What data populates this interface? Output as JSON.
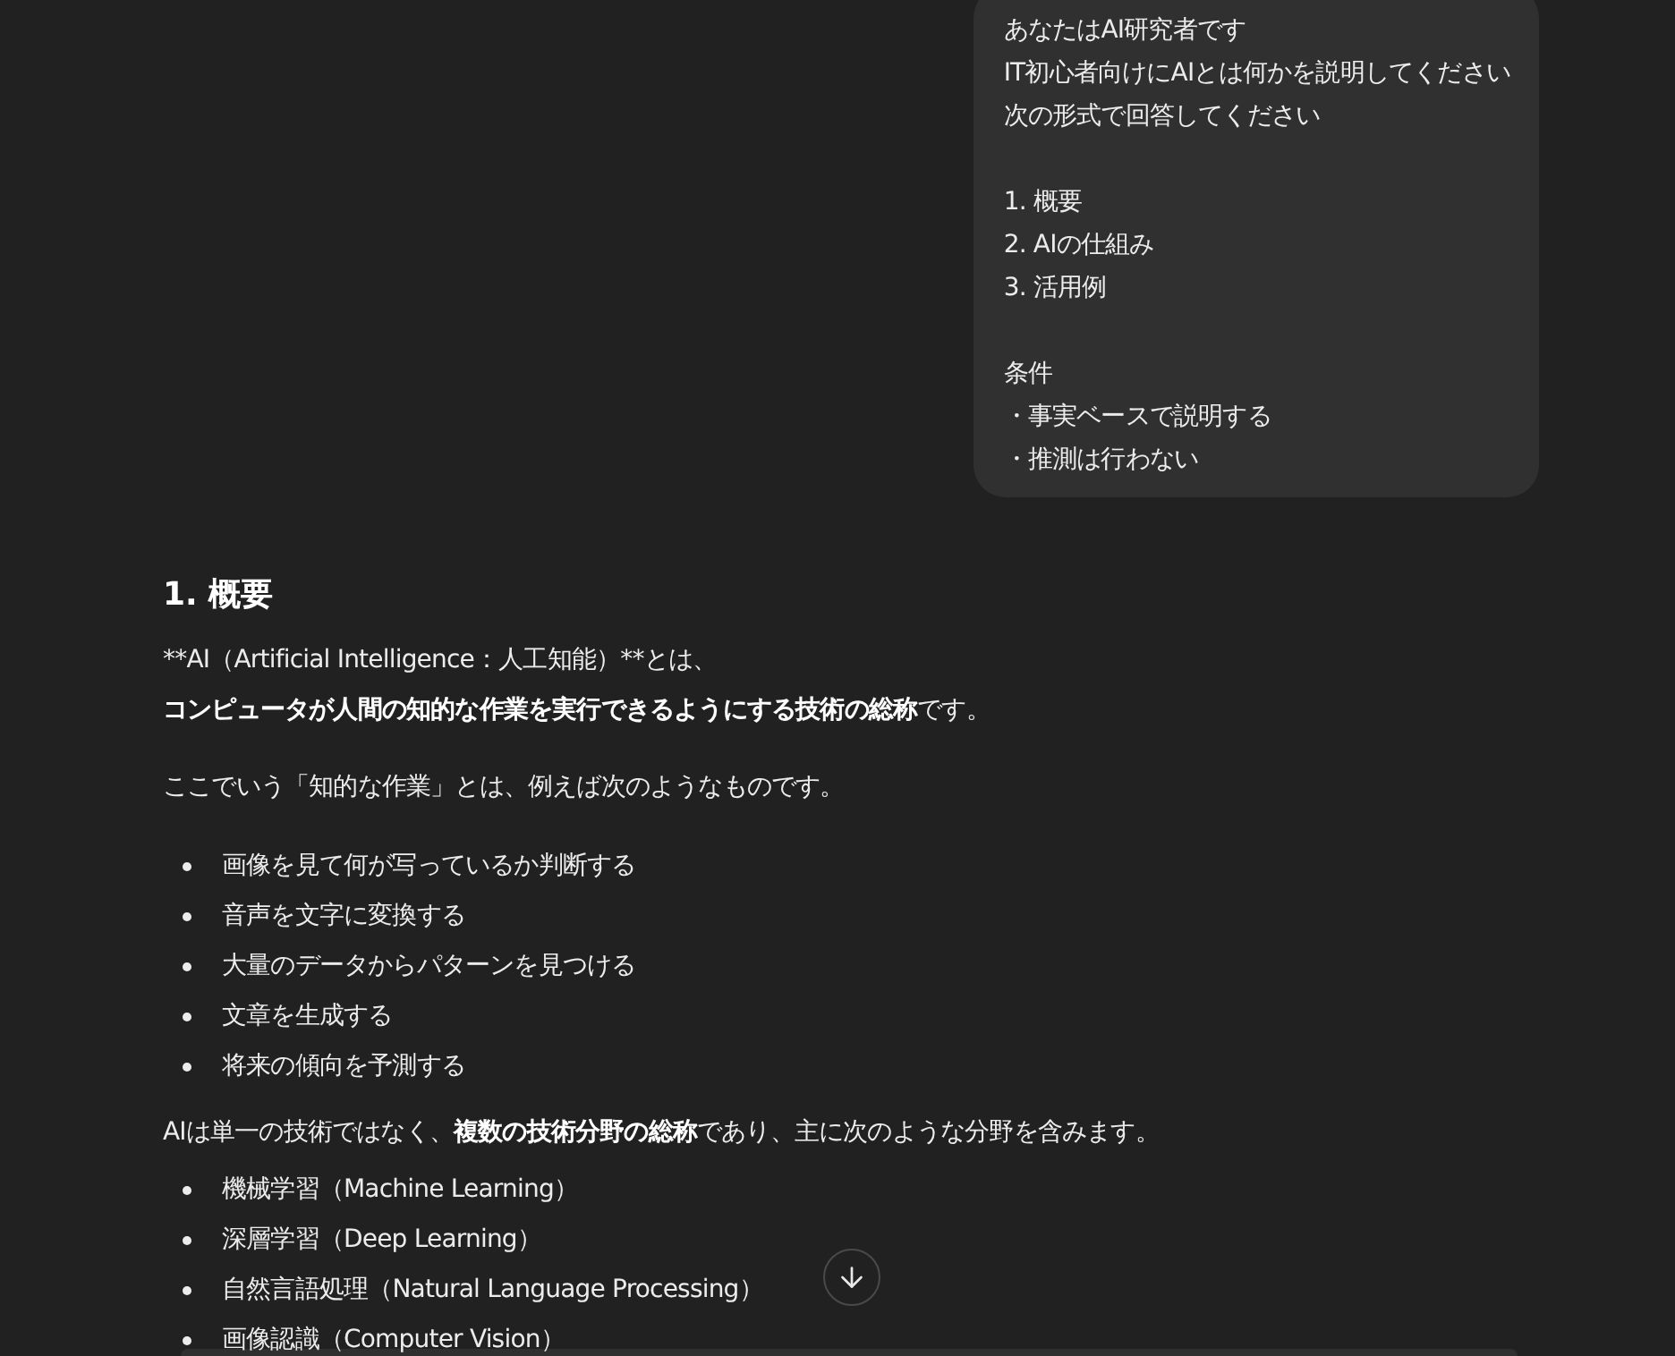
{
  "user_message": {
    "groups": [
      [
        "あなたはAI研究者です",
        "IT初心者向けにAIとは何かを説明してください",
        "次の形式で回答してください"
      ],
      [
        "1. 概要",
        "2. AIの仕組み",
        "3. 活用例"
      ],
      [
        "条件",
        "・事実ベースで説明する",
        "・推測は行わない"
      ]
    ]
  },
  "answer": {
    "blocks": [
      {
        "kind": "heading",
        "text": "1. 概要"
      },
      {
        "kind": "paragraph",
        "lines": [
          {
            "kind": "plain",
            "text": "**AI（Artificial Intelligence：人工知能）**とは、"
          },
          {
            "kind": "rich",
            "text": "**コンピュータが人間の知的な作業を実行できるようにする技術の総称**です。"
          }
        ]
      },
      {
        "kind": "paragraph",
        "lines": [
          {
            "kind": "plain",
            "text": "ここでいう「知的な作業」とは、例えば次のようなものです。"
          }
        ]
      },
      {
        "kind": "list",
        "items": [
          "画像を見て何が写っているか判断する",
          "音声を文字に変換する",
          "大量のデータからパターンを見つける",
          "文章を生成する",
          "将来の傾向を予測する"
        ]
      },
      {
        "kind": "paragraph",
        "lines": [
          {
            "kind": "rich",
            "text": "AIは単一の技術ではなく、**複数の技術分野の総称**であり、主に次のような分野を含みます。"
          }
        ]
      },
      {
        "kind": "list",
        "items": [
          "機械学習（Machine Learning）",
          "深層学習（Deep Learning）",
          "自然言語処理（Natural Language Processing）",
          "画像認識（Computer Vision）"
        ]
      }
    ]
  }
}
